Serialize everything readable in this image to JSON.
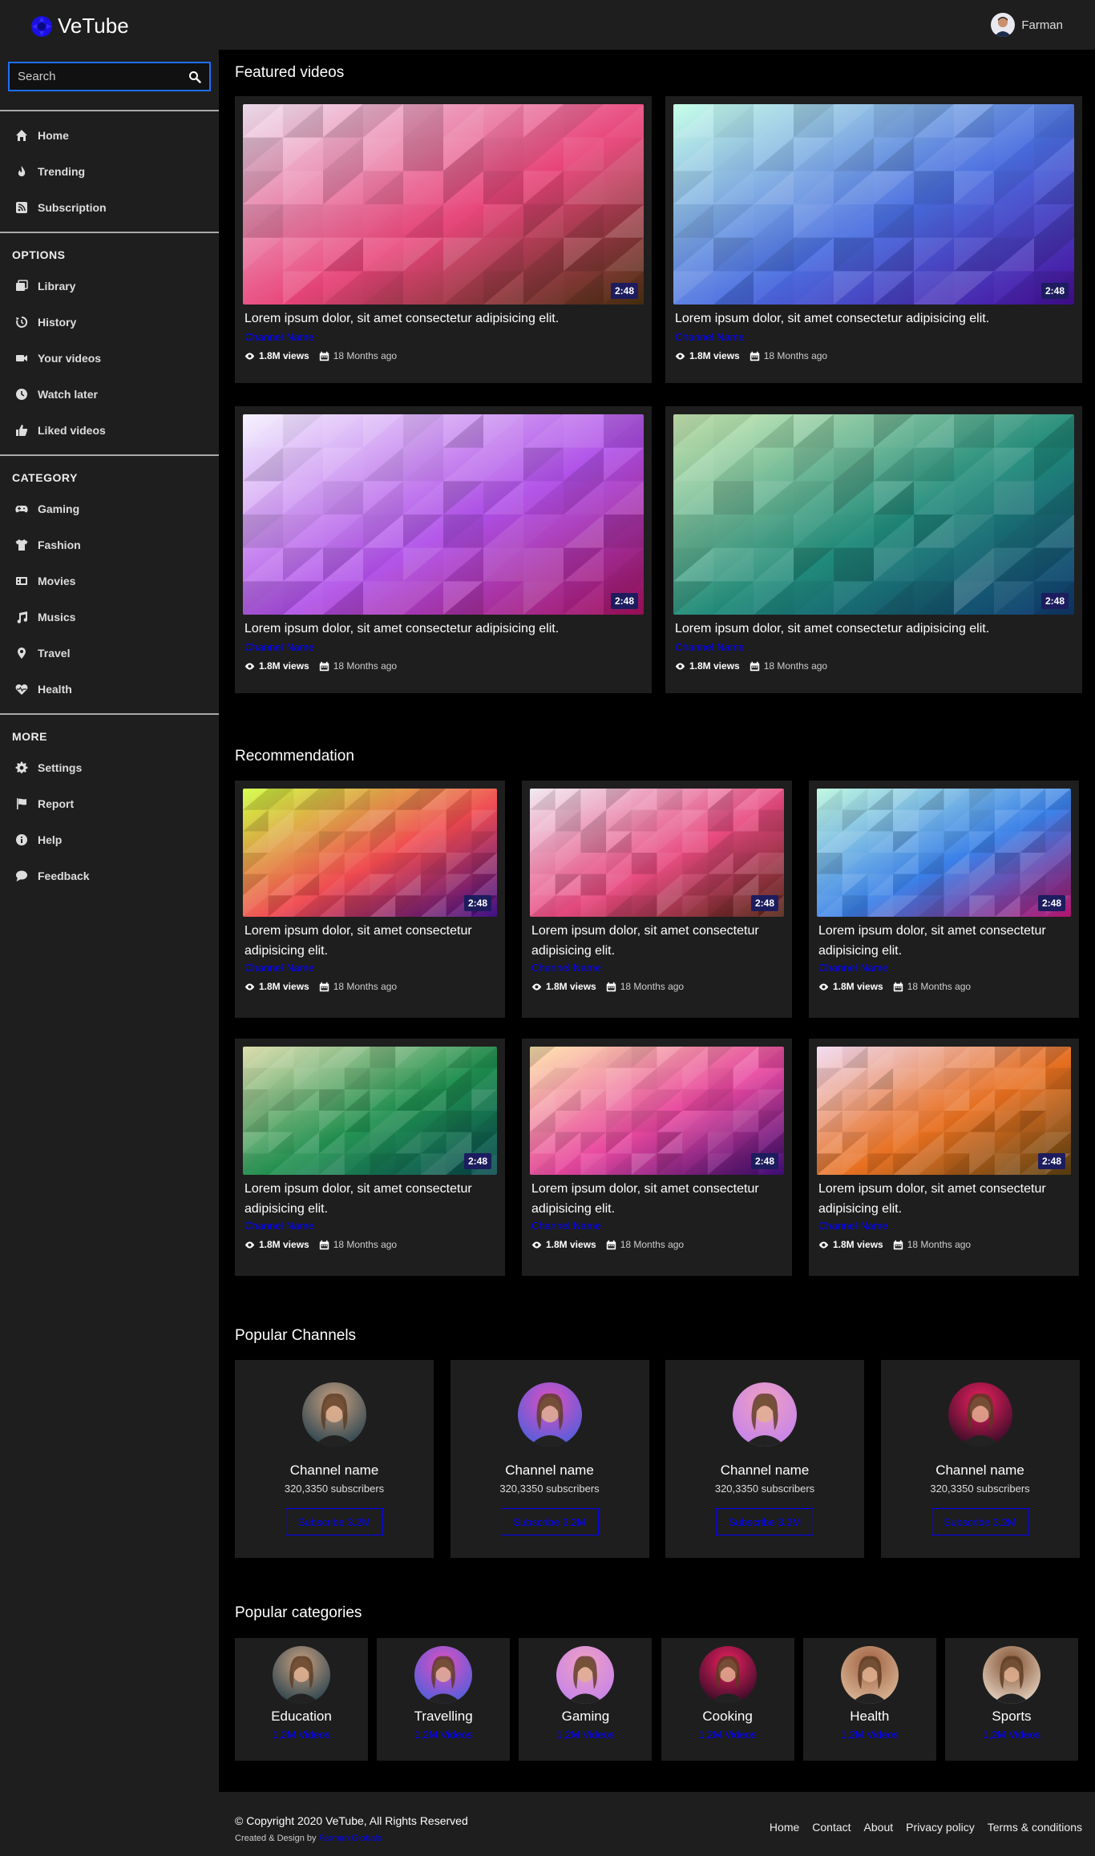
{
  "header": {
    "logo_text": "VeTube",
    "user_name": "Farman"
  },
  "sidebar": {
    "search_placeholder": "Search",
    "main_items": [
      {
        "label": "Home",
        "icon": "home-icon"
      },
      {
        "label": "Trending",
        "icon": "fire-icon"
      },
      {
        "label": "Subscription",
        "icon": "rss-icon"
      }
    ],
    "options_title": "OPTIONS",
    "options_items": [
      {
        "label": "Library",
        "icon": "library-icon"
      },
      {
        "label": "History",
        "icon": "history-icon"
      },
      {
        "label": "Your videos",
        "icon": "video-icon"
      },
      {
        "label": "Watch later",
        "icon": "clock-icon"
      },
      {
        "label": "Liked videos",
        "icon": "thumbs-up-icon"
      }
    ],
    "category_title": "CATEGORY",
    "category_items": [
      {
        "label": "Gaming",
        "icon": "gamepad-icon"
      },
      {
        "label": "Fashion",
        "icon": "tshirt-icon"
      },
      {
        "label": "Movies",
        "icon": "film-icon"
      },
      {
        "label": "Musics",
        "icon": "music-icon"
      },
      {
        "label": "Travel",
        "icon": "map-pin-icon"
      },
      {
        "label": "Health",
        "icon": "heartbeat-icon"
      }
    ],
    "more_title": "MORE",
    "more_items": [
      {
        "label": "Settings",
        "icon": "gear-icon"
      },
      {
        "label": "Report",
        "icon": "flag-icon"
      },
      {
        "label": "Help",
        "icon": "info-icon"
      },
      {
        "label": "Feedback",
        "icon": "comment-icon"
      }
    ]
  },
  "featured": {
    "heading": "Featured videos",
    "videos": [
      {
        "title": "Lorem ipsum dolor, sit amet consectetur adipisicing elit.",
        "channel": "Channel Name",
        "views": "1.8M views",
        "date": "18 Months ago",
        "duration": "2:48",
        "colors": [
          "#f0e0f0",
          "#e8457a",
          "#4a3010"
        ]
      },
      {
        "title": "Lorem ipsum dolor, sit amet consectetur adipisicing elit.",
        "channel": "Channel Name",
        "views": "1.8M views",
        "date": "18 Months ago",
        "duration": "2:48",
        "colors": [
          "#c8ffe8",
          "#4a6ee0",
          "#4a0ea0"
        ]
      },
      {
        "title": "Lorem ipsum dolor, sit amet consectetur adipisicing elit.",
        "channel": "Channel Name",
        "views": "1.8M views",
        "date": "18 Months ago",
        "duration": "2:48",
        "colors": [
          "#f4f0ff",
          "#b050e8",
          "#a0105a"
        ]
      },
      {
        "title": "Lorem ipsum dolor, sit amet consectetur adipisicing elit.",
        "channel": "Channel Name",
        "views": "1.8M views",
        "date": "18 Months ago",
        "duration": "2:48",
        "colors": [
          "#d0f0b8",
          "#208a7a",
          "#103a70"
        ]
      }
    ]
  },
  "recommendation": {
    "heading": "Recommendation",
    "videos": [
      {
        "title": "Lorem ipsum dolor, sit amet consectetur adipisicing elit.",
        "channel": "Channel Name",
        "views": "1.8M views",
        "date": "18 Months ago",
        "duration": "2:48",
        "colors": [
          "#d0ff40",
          "#f04a50",
          "#3a0a80"
        ]
      },
      {
        "title": "Lorem ipsum dolor, sit amet consectetur adipisicing elit.",
        "channel": "Channel Name",
        "views": "1.8M views",
        "date": "18 Months ago",
        "duration": "2:48",
        "colors": [
          "#f0e8f0",
          "#e84a80",
          "#502010"
        ]
      },
      {
        "title": "Lorem ipsum dolor, sit amet consectetur adipisicing elit.",
        "channel": "Channel Name",
        "views": "1.8M views",
        "date": "18 Months ago",
        "duration": "2:48",
        "colors": [
          "#c0f8e0",
          "#3a80e8",
          "#b0106a"
        ]
      },
      {
        "title": "Lorem ipsum dolor, sit amet consectetur adipisicing elit.",
        "channel": "Channel Name",
        "views": "1.8M views",
        "date": "18 Months ago",
        "duration": "2:48",
        "colors": [
          "#e0e0b0",
          "#209050",
          "#084a50"
        ]
      },
      {
        "title": "Lorem ipsum dolor, sit amet consectetur adipisicing elit.",
        "channel": "Channel Name",
        "views": "1.8M views",
        "date": "18 Months ago",
        "duration": "2:48",
        "colors": [
          "#ffe8b0",
          "#e848a0",
          "#3a0a70"
        ]
      },
      {
        "title": "Lorem ipsum dolor, sit amet consectetur adipisicing elit.",
        "channel": "Channel Name",
        "views": "1.8M views",
        "date": "18 Months ago",
        "duration": "2:48",
        "colors": [
          "#f0d8f0",
          "#e87020",
          "#5a4010"
        ]
      }
    ]
  },
  "channels": {
    "heading": "Popular Channels",
    "items": [
      {
        "name": "Channel name",
        "subs": "320,3350 subscribers",
        "button": "Subscribe 3.2M",
        "colors": [
          "#1a3a4a",
          "#c8a080"
        ]
      },
      {
        "name": "Channel name",
        "subs": "320,3350 subscribers",
        "button": "Subscribe 3.2M",
        "colors": [
          "#4060e0",
          "#e050c0"
        ]
      },
      {
        "name": "Channel name",
        "subs": "320,3350 subscribers",
        "button": "Subscribe 3.2M",
        "colors": [
          "#c080f0",
          "#f0a0c0"
        ]
      },
      {
        "name": "Channel name",
        "subs": "320,3350 subscribers",
        "button": "Subscribe 3.2M",
        "colors": [
          "#200a20",
          "#f02060"
        ]
      }
    ]
  },
  "categories": {
    "heading": "Popular categories",
    "items": [
      {
        "name": "Education",
        "count": "1,2M Videos",
        "colors": [
          "#1a3a4a",
          "#c8a080"
        ]
      },
      {
        "name": "Travelling",
        "count": "1,2M Videos",
        "colors": [
          "#4060e0",
          "#e050c0"
        ]
      },
      {
        "name": "Gaming",
        "count": "1,2M Videos",
        "colors": [
          "#c080f0",
          "#f0a0c0"
        ]
      },
      {
        "name": "Cooking",
        "count": "1,2M Videos",
        "colors": [
          "#200a20",
          "#f02060"
        ]
      },
      {
        "name": "Health",
        "count": "1,2M Videos",
        "colors": [
          "#e0c0a0",
          "#a06040"
        ]
      },
      {
        "name": "Sports",
        "count": "1,2M Videos",
        "colors": [
          "#f0e0d0",
          "#805030"
        ]
      }
    ]
  },
  "footer": {
    "copyright": "© Copyright 2020 VeTube, All Rights Reserved",
    "created_prefix": "Created & Design by",
    "created_author": "Farman Globals",
    "links": [
      "Home",
      "Contact",
      "About",
      "Privacy policy",
      "Terms & conditions"
    ]
  },
  "colors": {
    "accent": "#0000ff",
    "search_border": "#1e6fff",
    "panel": "#1e1e1e",
    "background": "#000000"
  }
}
